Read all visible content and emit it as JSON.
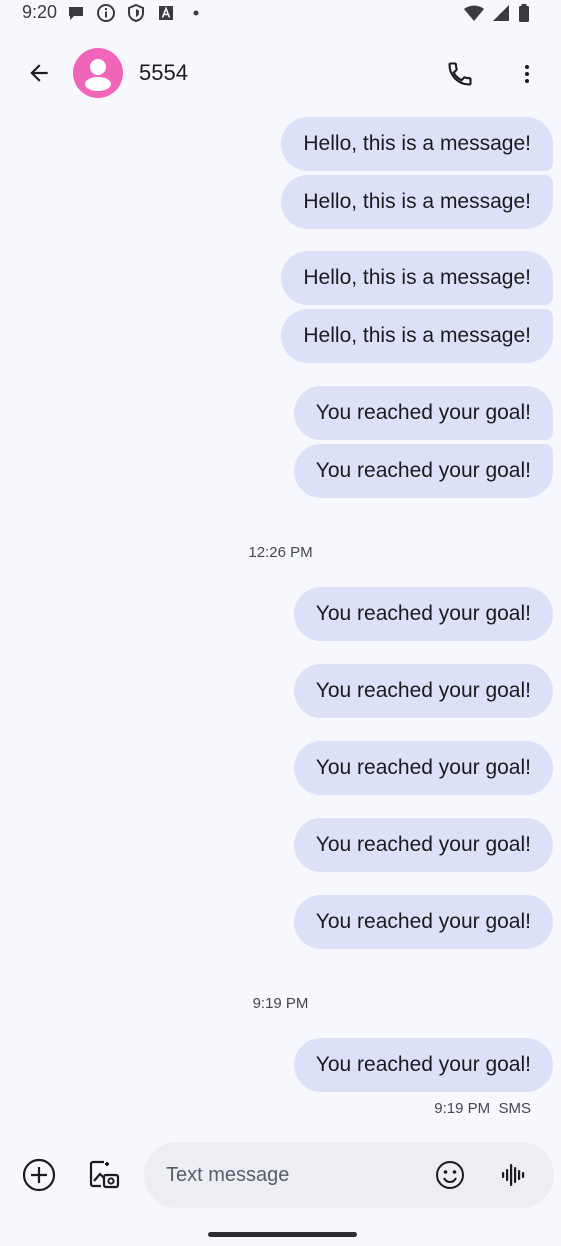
{
  "status_bar": {
    "time": "9:20",
    "left_icons": [
      "chat-bubble-icon",
      "info-icon",
      "shield-icon",
      "font-a-icon",
      "dot-icon"
    ],
    "right_icons": [
      "wifi-icon",
      "signal-icon",
      "battery-icon"
    ]
  },
  "header": {
    "contact_name": "5554",
    "avatar_color": "#f165b9"
  },
  "messages": {
    "m1": "Hello, this is a message!",
    "m2": "Hello, this is a message!",
    "m3": "Hello, this is a message!",
    "m4": "Hello, this is a message!",
    "m5": "You reached your goal!",
    "m6": "You reached your goal!",
    "m7": "You reached your goal!",
    "m8": "You reached your goal!",
    "m9": "You reached your goal!",
    "m10": "You reached your goal!",
    "m11": "You reached your goal!",
    "m12": "You reached your goal!"
  },
  "timestamps": {
    "t1": "12:26 PM",
    "t2": "9:19 PM"
  },
  "last_status": "9:19 PM  SMS",
  "compose": {
    "placeholder": "Text message"
  },
  "colors": {
    "bubble": "#dde1f8",
    "background": "#f7f8fd",
    "input": "#eceef3"
  }
}
